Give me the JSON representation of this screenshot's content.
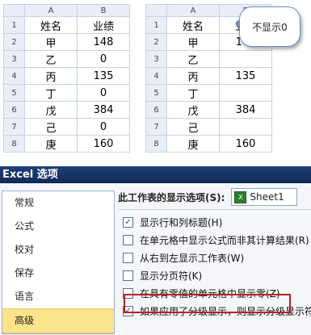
{
  "left_sheet": {
    "columns": [
      "A",
      "B"
    ],
    "rows": [
      {
        "num": "1",
        "a": "姓名",
        "b": "业绩"
      },
      {
        "num": "2",
        "a": "甲",
        "b": "148"
      },
      {
        "num": "3",
        "a": "乙",
        "b": "0"
      },
      {
        "num": "4",
        "a": "丙",
        "b": "135"
      },
      {
        "num": "5",
        "a": "丁",
        "b": "0"
      },
      {
        "num": "6",
        "a": "戊",
        "b": "384"
      },
      {
        "num": "7",
        "a": "己",
        "b": "0"
      },
      {
        "num": "8",
        "a": "庚",
        "b": "160"
      }
    ]
  },
  "right_sheet": {
    "columns": [
      "A",
      "B"
    ],
    "rows": [
      {
        "num": "1",
        "a": "姓名",
        "b": "业绩"
      },
      {
        "num": "2",
        "a": "甲",
        "b": "148"
      },
      {
        "num": "3",
        "a": "乙",
        "b": ""
      },
      {
        "num": "4",
        "a": "丙",
        "b": "135"
      },
      {
        "num": "5",
        "a": "丁",
        "b": ""
      },
      {
        "num": "6",
        "a": "戊",
        "b": "384"
      },
      {
        "num": "7",
        "a": "己",
        "b": ""
      },
      {
        "num": "8",
        "a": "庚",
        "b": "160"
      }
    ]
  },
  "callout": {
    "text": "不显示0"
  },
  "dialog": {
    "title": "Excel 选项",
    "nav_items": [
      "常规",
      "公式",
      "校对",
      "保存",
      "语言",
      "高级"
    ],
    "selected_nav": "高级",
    "options_header": "此工作表的显示选项(S):",
    "sheet_name": "Sheet1",
    "options": [
      {
        "label": "显示行和列标题(H)",
        "checked": true
      },
      {
        "label": "在单元格中显示公式而非其计算结果(R)",
        "checked": false
      },
      {
        "label": "从右到左显示工作表(W)",
        "checked": false
      },
      {
        "label": "显示分页符(K)",
        "checked": false
      },
      {
        "label": "在具有零值的单元格中显示零(Z)",
        "checked": false
      },
      {
        "label": "如果应用了分级显示，则显示分级显示符号(O)",
        "checked": true
      }
    ]
  },
  "colors": {
    "highlight": "#b22424",
    "selected_nav": "#fce48d",
    "title_bar": "#1e3f7a"
  }
}
